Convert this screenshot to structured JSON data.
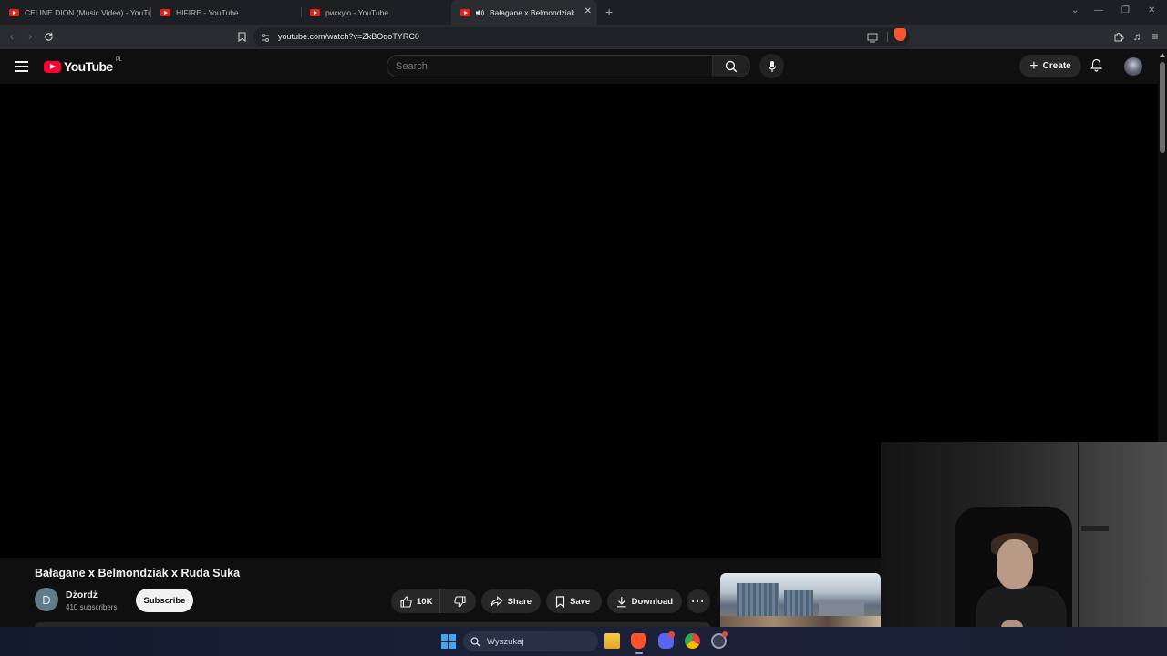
{
  "browser": {
    "tabs": [
      {
        "title": "CELINE DION (Music Video) - YouTube",
        "active": false
      },
      {
        "title": "HIFIRE - YouTube",
        "active": false
      },
      {
        "title": "рискую - YouTube",
        "active": false
      },
      {
        "title": "Bałagane x Belmondziak x Ruda Suka",
        "active": true,
        "audio_icon": "speaker-icon"
      }
    ],
    "url": "youtube.com/watch?v=ZkBOqoTYRC0",
    "window_controls": [
      "chevron-down-icon",
      "minimize-icon",
      "restore-icon",
      "close-icon"
    ]
  },
  "youtube": {
    "logo_text": "YouTube",
    "country_code": "PL",
    "search_placeholder": "Search",
    "create_label": "Create",
    "accent_color": "#ff0033"
  },
  "video": {
    "title": "Bałagane x Belmondziak x Ruda Suka",
    "channel": {
      "initial": "D",
      "name": "Dżordż",
      "subscribers": "410 subscribers"
    },
    "subscribe_label": "Subscribe",
    "likes": "10K",
    "share_label": "Share",
    "save_label": "Save",
    "download_label": "Download"
  },
  "taskbar": {
    "search_placeholder": "Wyszukaj",
    "apps": [
      "file-explorer-icon",
      "brave-icon",
      "discord-icon",
      "chrome-icon",
      "settings-icon"
    ]
  }
}
